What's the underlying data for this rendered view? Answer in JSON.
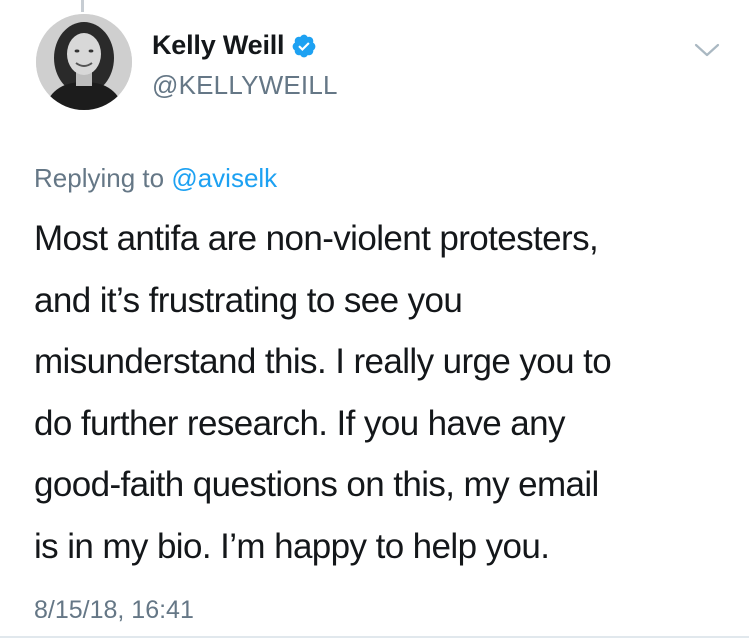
{
  "author": {
    "display_name": "Kelly Weill",
    "handle": "@KELLYWEILL",
    "verified": true,
    "avatar_icon": "profile-photo"
  },
  "reply": {
    "prefix": "Replying to ",
    "target": "@aviselk"
  },
  "tweet": {
    "lines": [
      "Most antifa are non-violent protesters,",
      "and it’s frustrating to see you",
      "misunderstand this. I really urge you to",
      "do further research. If you have any",
      "good-faith questions on this, my email",
      "is in my bio. I’m happy to help you."
    ],
    "timestamp": "8/15/18, 16:41"
  },
  "colors": {
    "text": "#14171a",
    "secondary": "#657786",
    "link": "#1da1f2",
    "verified": "#1da1f2",
    "divider": "#e1e8ed"
  },
  "icons": {
    "verified": "verified-badge-icon",
    "menu": "chevron-down-icon"
  }
}
